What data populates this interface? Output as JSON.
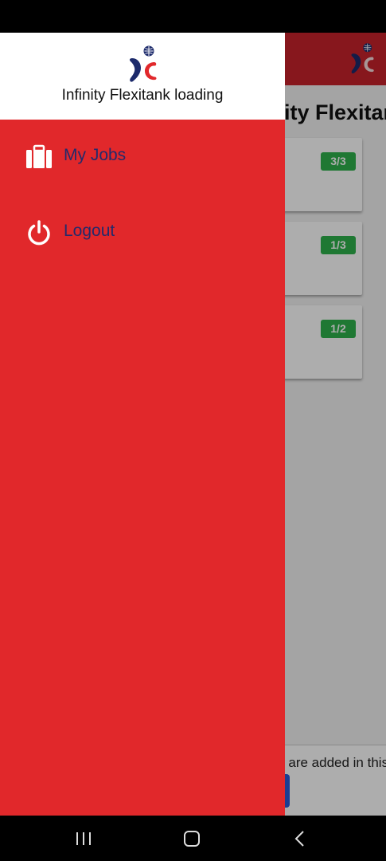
{
  "app": {
    "title": "Infinity Flexitank loading",
    "jobs": [
      {
        "badge": "3/3"
      },
      {
        "badge": "1/3"
      },
      {
        "badge": "1/2"
      }
    ],
    "footer_text": "No jobs are added in this list."
  },
  "drawer": {
    "title": "Infinity Flexitank loading",
    "items": [
      {
        "label": "My Jobs",
        "icon": "briefcase-icon"
      },
      {
        "label": "Logout",
        "icon": "power-icon"
      }
    ]
  },
  "nav": {
    "recents": "recent-apps-icon",
    "home": "home-icon",
    "back": "back-icon"
  },
  "colors": {
    "drawer_bg": "#e1282b",
    "header_red": "#c8232b",
    "menu_text": "#232a6b",
    "badge_green": "#2fb24c",
    "logo_blue": "#1c2a6b",
    "logo_red": "#e1282b"
  }
}
